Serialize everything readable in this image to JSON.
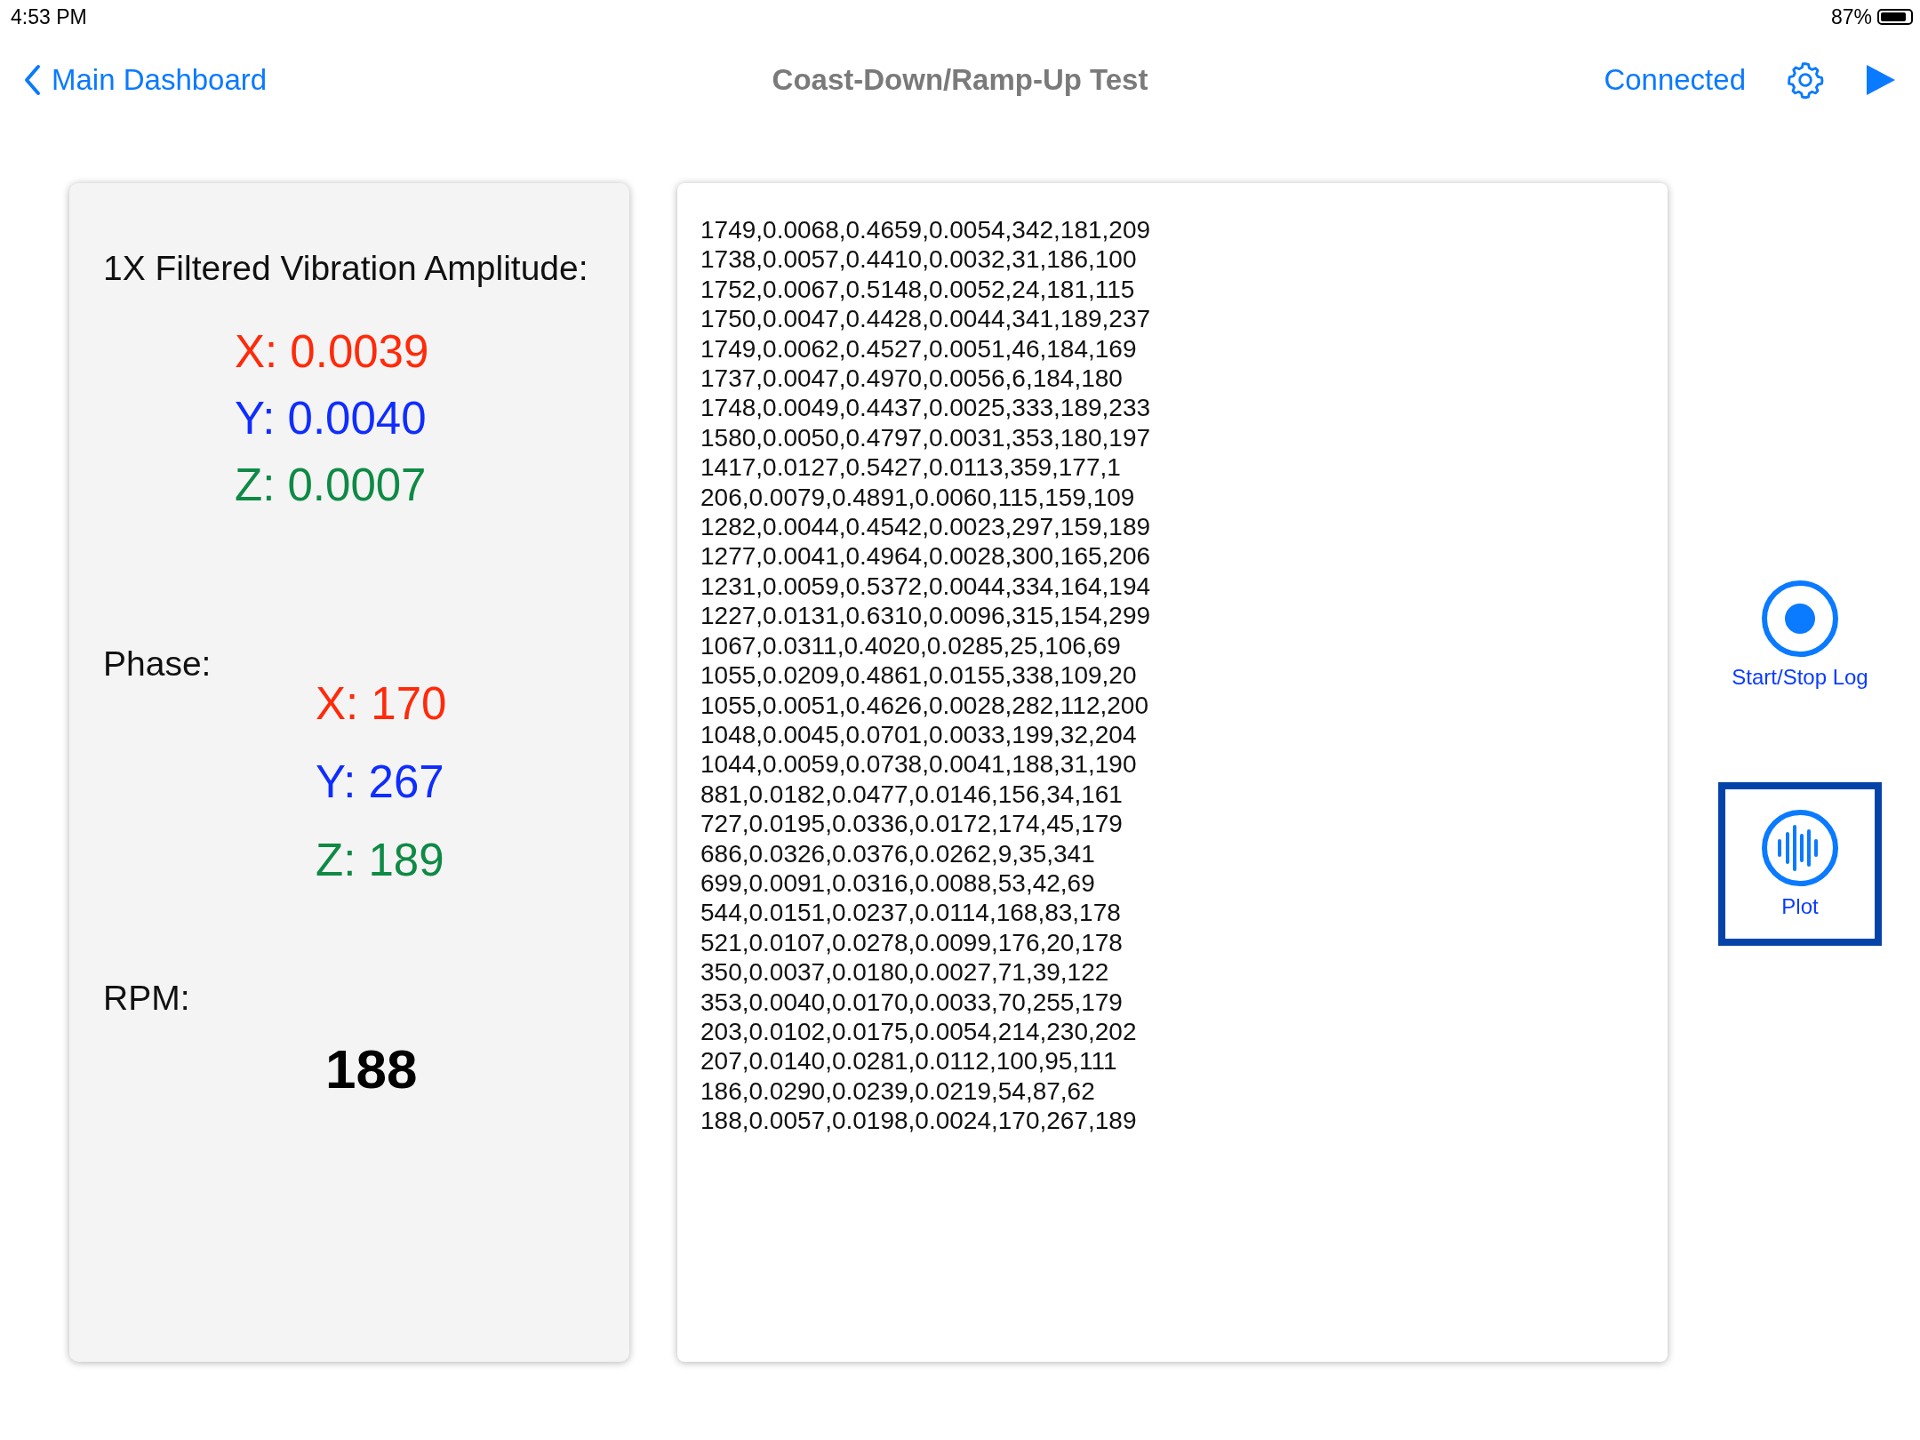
{
  "status_bar": {
    "time": "4:53 PM",
    "battery_text": "87%"
  },
  "nav": {
    "back_label": "Main Dashboard",
    "title": "Coast-Down/Ramp-Up Test",
    "connection": "Connected"
  },
  "amplitude": {
    "heading": "1X Filtered Vibration Amplitude:",
    "values": [
      {
        "color": "#ff2a0a",
        "text": "X: 0.0039"
      },
      {
        "color": "#0f2dff",
        "text": "Y: 0.0040"
      },
      {
        "color": "#0e8a45",
        "text": "Z: 0.0007"
      }
    ]
  },
  "phase": {
    "heading": "Phase:",
    "values": [
      {
        "color": "#ff2a0a",
        "text": "X: 170"
      },
      {
        "color": "#0f2dff",
        "text": "Y: 267"
      },
      {
        "color": "#0e8a45",
        "text": "Z: 189"
      }
    ]
  },
  "rpm": {
    "heading": "RPM:",
    "value": "188"
  },
  "log_lines": [
    "1749,0.0068,0.4659,0.0054,342,181,209",
    "1738,0.0057,0.4410,0.0032,31,186,100",
    "1752,0.0067,0.5148,0.0052,24,181,115",
    "1750,0.0047,0.4428,0.0044,341,189,237",
    "1749,0.0062,0.4527,0.0051,46,184,169",
    "1737,0.0047,0.4970,0.0056,6,184,180",
    "1748,0.0049,0.4437,0.0025,333,189,233",
    "1580,0.0050,0.4797,0.0031,353,180,197",
    "1417,0.0127,0.5427,0.0113,359,177,1",
    "206,0.0079,0.4891,0.0060,115,159,109",
    "1282,0.0044,0.4542,0.0023,297,159,189",
    "1277,0.0041,0.4964,0.0028,300,165,206",
    "1231,0.0059,0.5372,0.0044,334,164,194",
    "1227,0.0131,0.6310,0.0096,315,154,299",
    "1067,0.0311,0.4020,0.0285,25,106,69",
    "1055,0.0209,0.4861,0.0155,338,109,20",
    "1055,0.0051,0.4626,0.0028,282,112,200",
    "1048,0.0045,0.0701,0.0033,199,32,204",
    "1044,0.0059,0.0738,0.0041,188,31,190",
    "881,0.0182,0.0477,0.0146,156,34,161",
    "727,0.0195,0.0336,0.0172,174,45,179",
    "686,0.0326,0.0376,0.0262,9,35,341",
    "699,0.0091,0.0316,0.0088,53,42,69",
    "544,0.0151,0.0237,0.0114,168,83,178",
    "521,0.0107,0.0278,0.0099,176,20,178",
    "350,0.0037,0.0180,0.0027,71,39,122",
    "353,0.0040,0.0170,0.0033,70,255,179",
    "203,0.0102,0.0175,0.0054,214,230,202",
    "207,0.0140,0.0281,0.0112,100,95,111",
    "186,0.0290,0.0239,0.0219,54,87,62",
    "188,0.0057,0.0198,0.0024,170,267,189"
  ],
  "actions": [
    {
      "kind": "record",
      "label": "Start/Stop Log",
      "focused": false
    },
    {
      "kind": "plot",
      "label": "Plot",
      "focused": true
    }
  ]
}
